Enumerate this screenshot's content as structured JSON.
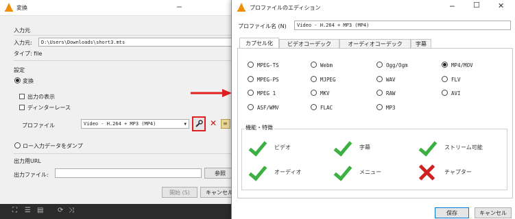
{
  "convert_window": {
    "title": "変換",
    "source_group": "入力元",
    "source_label": "入力元:",
    "source_value": "D:\\Users\\Downloads\\short3.mts",
    "type_label": "タイプ: file",
    "settings_group": "設定",
    "convert_radio": "変換",
    "show_output": "出力の表示",
    "deinterlace": "ディンターレース",
    "profile_label": "プロファイル",
    "profile_value": "Video - H.264 + MP3 (MP4)",
    "dump_raw": "ロー入力データをダンプ",
    "dest_group": "出力用URL",
    "dest_label": "出力ファイル:",
    "browse_button": "参照",
    "start_button": "開始 (S)",
    "cancel_button": "キャンセル"
  },
  "profile_window": {
    "title": "プロファイルのエディション",
    "name_label": "プロファイル名 (N)",
    "name_value": "Video - H.264 + MP3 (MP4)",
    "tabs": [
      "カプセル化",
      "ビデオコーデック",
      "オーディオコーデック",
      "字幕"
    ],
    "formats": [
      {
        "label": "MPEG-TS",
        "selected": false
      },
      {
        "label": "Webm",
        "selected": false
      },
      {
        "label": "Ogg/Ogm",
        "selected": false
      },
      {
        "label": "MP4/MOV",
        "selected": true
      },
      {
        "label": "MPEG-PS",
        "selected": false
      },
      {
        "label": "MJPEG",
        "selected": false
      },
      {
        "label": "WAV",
        "selected": false
      },
      {
        "label": "FLV",
        "selected": false
      },
      {
        "label": "MPEG 1",
        "selected": false
      },
      {
        "label": "MKV",
        "selected": false
      },
      {
        "label": "RAW",
        "selected": false
      },
      {
        "label": "AVI",
        "selected": false
      },
      {
        "label": "ASF/WMV",
        "selected": false
      },
      {
        "label": "FLAC",
        "selected": false
      },
      {
        "label": "MP3",
        "selected": false
      }
    ],
    "features_group": "機能・特徴",
    "features": [
      {
        "label": "ビデオ",
        "supported": true
      },
      {
        "label": "字幕",
        "supported": true
      },
      {
        "label": "ストリーム可能",
        "supported": true
      },
      {
        "label": "オーディオ",
        "supported": true
      },
      {
        "label": "メニュー",
        "supported": true
      },
      {
        "label": "チャプター",
        "supported": false
      }
    ],
    "save_button": "保存",
    "cancel_button": "キャンセル"
  },
  "colors": {
    "accent_red": "#e02020",
    "check_green": "#3cb043",
    "cross_red": "#cc2222",
    "vlc_orange": "#f28c00"
  },
  "icons": {
    "wrench": "wrench-icon",
    "delete": "red-x-icon",
    "new_profile": "new-profile-icon",
    "arrow": "red-arrow-icon"
  }
}
